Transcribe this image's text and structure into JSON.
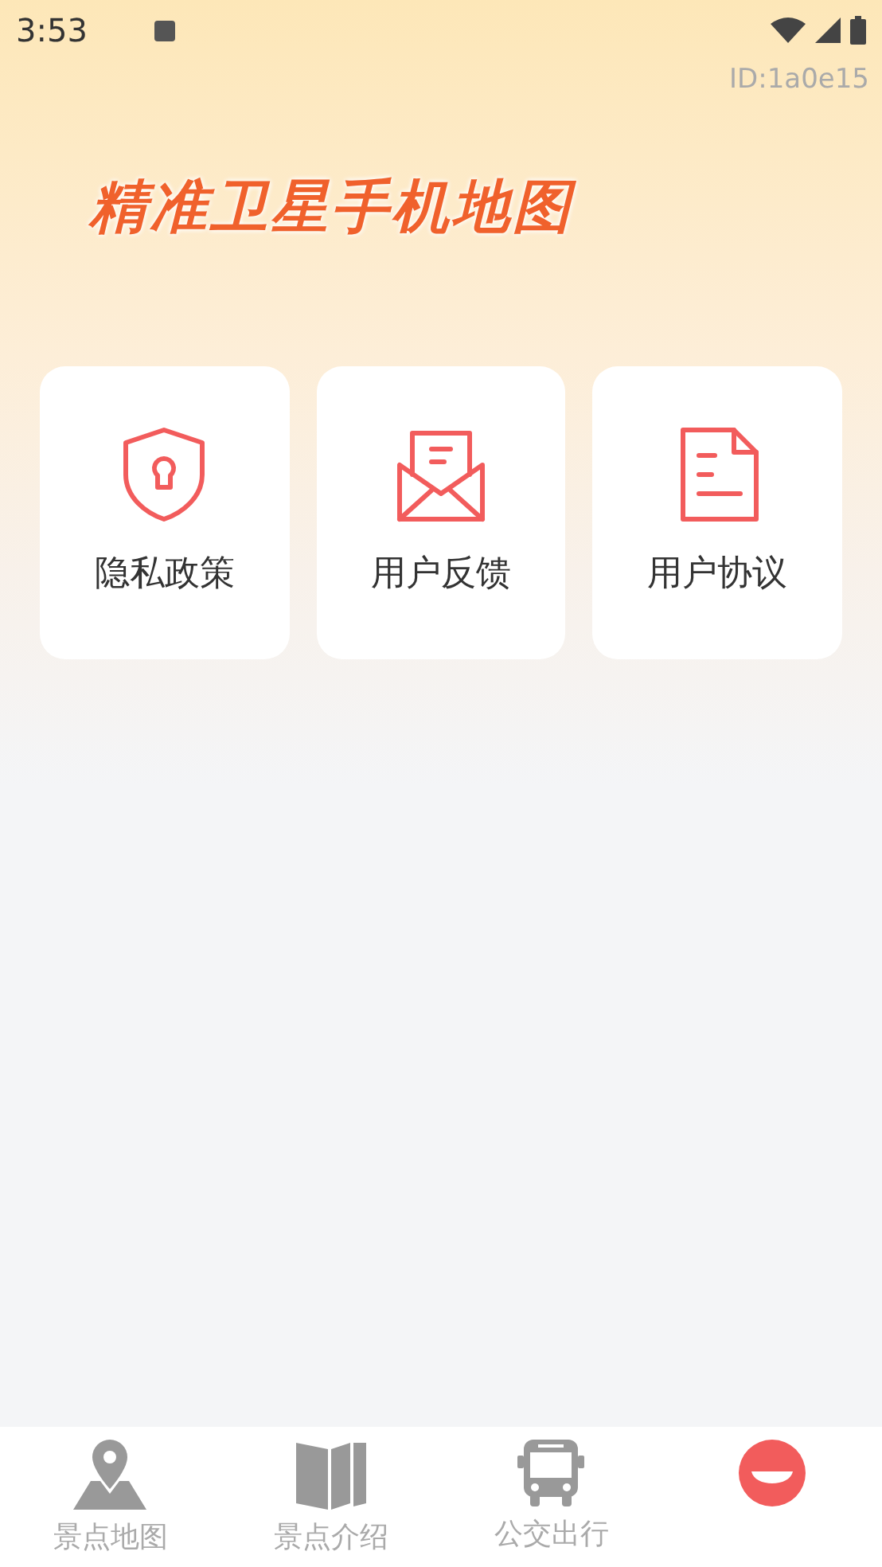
{
  "status_bar": {
    "time": "3:53"
  },
  "header": {
    "id_label": "ID:1a0e15",
    "title": "精准卫星手机地图"
  },
  "cards": [
    {
      "kind": "privacy",
      "label": "隐私政策"
    },
    {
      "kind": "feedback",
      "label": "用户反馈"
    },
    {
      "kind": "agreement",
      "label": "用户协议"
    }
  ],
  "tabs": [
    {
      "kind": "map",
      "label": "景点地图",
      "selected": false
    },
    {
      "kind": "book",
      "label": "景点介绍",
      "selected": false
    },
    {
      "kind": "bus",
      "label": "公交出行",
      "selected": false
    },
    {
      "kind": "me",
      "selected": true
    }
  ]
}
